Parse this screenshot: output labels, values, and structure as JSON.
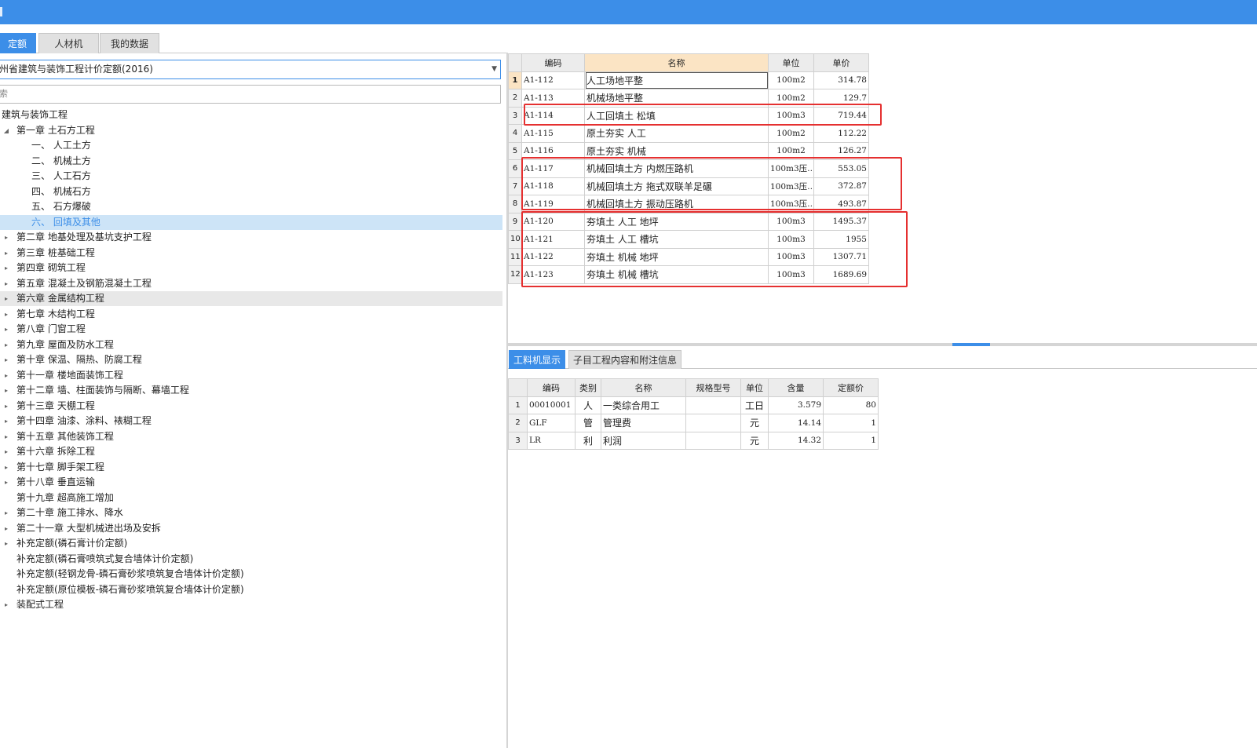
{
  "top_tabs": [
    "定额",
    "人材机",
    "我的数据"
  ],
  "library_select": "州省建筑与装饰工程计价定额(2016)",
  "search_text": "索",
  "tree": [
    {
      "label": "建筑与装饰工程",
      "toggle": "none"
    },
    {
      "label": "第一章 土石方工程",
      "toggle": "expanded"
    },
    {
      "label": "一、 人工土方",
      "toggle": "none"
    },
    {
      "label": "二、 机械土方",
      "toggle": "none"
    },
    {
      "label": "三、 人工石方",
      "toggle": "none"
    },
    {
      "label": "四、 机械石方",
      "toggle": "none"
    },
    {
      "label": "五、 石方爆破",
      "toggle": "none"
    },
    {
      "label": "六、 回填及其他",
      "toggle": "none"
    },
    {
      "label": "第二章 地基处理及基坑支护工程",
      "toggle": "collapsed"
    },
    {
      "label": "第三章 桩基础工程",
      "toggle": "collapsed"
    },
    {
      "label": "第四章 砌筑工程",
      "toggle": "collapsed"
    },
    {
      "label": "第五章 混凝土及钢筋混凝土工程",
      "toggle": "collapsed"
    },
    {
      "label": "第六章 金属结构工程",
      "toggle": "collapsed"
    },
    {
      "label": "第七章 木结构工程",
      "toggle": "collapsed"
    },
    {
      "label": "第八章 门窗工程",
      "toggle": "collapsed"
    },
    {
      "label": "第九章 屋面及防水工程",
      "toggle": "collapsed"
    },
    {
      "label": "第十章 保温、隔热、防腐工程",
      "toggle": "collapsed"
    },
    {
      "label": "第十一章 楼地面装饰工程",
      "toggle": "collapsed"
    },
    {
      "label": "第十二章 墙、柱面装饰与隔断、幕墙工程",
      "toggle": "collapsed"
    },
    {
      "label": "第十三章 天棚工程",
      "toggle": "collapsed"
    },
    {
      "label": "第十四章 油漆、涂料、裱糊工程",
      "toggle": "collapsed"
    },
    {
      "label": "第十五章 其他装饰工程",
      "toggle": "collapsed"
    },
    {
      "label": "第十六章 拆除工程",
      "toggle": "collapsed"
    },
    {
      "label": "第十七章 脚手架工程",
      "toggle": "collapsed"
    },
    {
      "label": "第十八章 垂直运输",
      "toggle": "collapsed"
    },
    {
      "label": "第十九章 超高施工增加",
      "toggle": "none"
    },
    {
      "label": "第二十章 施工排水、降水",
      "toggle": "collapsed"
    },
    {
      "label": "第二十一章 大型机械进出场及安拆",
      "toggle": "collapsed"
    },
    {
      "label": "补充定额(磷石膏计价定额)",
      "toggle": "collapsed"
    },
    {
      "label": "补充定额(磷石膏喷筑式复合墙体计价定额)",
      "toggle": "none"
    },
    {
      "label": "补充定额(轻钢龙骨-磷石膏砂浆喷筑复合墙体计价定额)",
      "toggle": "none"
    },
    {
      "label": "补充定额(原位模板-磷石膏砂浆喷筑复合墙体计价定额)",
      "toggle": "none"
    },
    {
      "label": "装配式工程",
      "toggle": "collapsed"
    }
  ],
  "quota_table": {
    "headers": [
      "",
      "编码",
      "名称",
      "单位",
      "单价"
    ],
    "rows": [
      {
        "n": "1",
        "code": "A1-112",
        "name": "人工场地平整",
        "unit": "100m2",
        "price": "314.78"
      },
      {
        "n": "2",
        "code": "A1-113",
        "name": "机械场地平整",
        "unit": "100m2",
        "price": "129.7"
      },
      {
        "n": "3",
        "code": "A1-114",
        "name": "人工回填土 松填",
        "unit": "100m3",
        "price": "719.44"
      },
      {
        "n": "4",
        "code": "A1-115",
        "name": "原土夯实 人工",
        "unit": "100m2",
        "price": "112.22"
      },
      {
        "n": "5",
        "code": "A1-116",
        "name": "原土夯实 机械",
        "unit": "100m2",
        "price": "126.27"
      },
      {
        "n": "6",
        "code": "A1-117",
        "name": "机械回填土方 内燃压路机",
        "unit": "100m3压…",
        "price": "553.05"
      },
      {
        "n": "7",
        "code": "A1-118",
        "name": "机械回填土方 拖式双联羊足碾",
        "unit": "100m3压…",
        "price": "372.87"
      },
      {
        "n": "8",
        "code": "A1-119",
        "name": "机械回填土方 振动压路机",
        "unit": "100m3压…",
        "price": "493.87"
      },
      {
        "n": "9",
        "code": "A1-120",
        "name": "夯填土 人工 地坪",
        "unit": "100m3",
        "price": "1495.37"
      },
      {
        "n": "10",
        "code": "A1-121",
        "name": "夯填土 人工 槽坑",
        "unit": "100m3",
        "price": "1955"
      },
      {
        "n": "11",
        "code": "A1-122",
        "name": "夯填土 机械 地坪",
        "unit": "100m3",
        "price": "1307.71"
      },
      {
        "n": "12",
        "code": "A1-123",
        "name": "夯填土 机械 槽坑",
        "unit": "100m3",
        "price": "1689.69"
      }
    ]
  },
  "bottom_tabs": [
    "工料机显示",
    "子目工程内容和附注信息"
  ],
  "resource_table": {
    "headers": [
      "",
      "编码",
      "类别",
      "名称",
      "规格型号",
      "单位",
      "含量",
      "定额价"
    ],
    "rows": [
      {
        "n": "1",
        "code": "00010001",
        "type": "人",
        "name": "一类综合用工",
        "spec": "",
        "unit": "工日",
        "qty": "3.579",
        "price": "80"
      },
      {
        "n": "2",
        "code": "GLF",
        "type": "管",
        "name": "管理费",
        "spec": "",
        "unit": "元",
        "qty": "14.14",
        "price": "1"
      },
      {
        "n": "3",
        "code": "LR",
        "type": "利",
        "name": "利润",
        "spec": "",
        "unit": "元",
        "qty": "14.32",
        "price": "1"
      }
    ]
  },
  "colors": {
    "accent": "#3c8ee8",
    "highlight_box": "#e53030",
    "selected_row": "#cde4f7"
  }
}
